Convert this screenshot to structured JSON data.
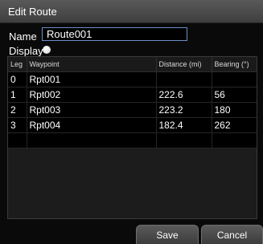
{
  "window": {
    "title": "Edit Route"
  },
  "form": {
    "name_label": "Name",
    "name_value": "Route001",
    "display_label": "Display"
  },
  "table": {
    "headers": [
      "Leg",
      "Waypoint",
      "Distance (mi)",
      "Bearing (°)"
    ],
    "rows": [
      [
        "0",
        "Rpt001",
        "",
        ""
      ],
      [
        "1",
        "Rpt002",
        "222.6",
        "56"
      ],
      [
        "2",
        "Rpt003",
        "223.2",
        "180"
      ],
      [
        "3",
        "Rpt004",
        "182.4",
        "262"
      ],
      [
        "",
        "",
        "",
        ""
      ]
    ]
  },
  "buttons": {
    "save_label": "Save",
    "cancel_label": "Cancel"
  },
  "colors": {
    "accent": "#6c8ec7",
    "background": "#000000",
    "titlebar": "#4a4a4a"
  }
}
